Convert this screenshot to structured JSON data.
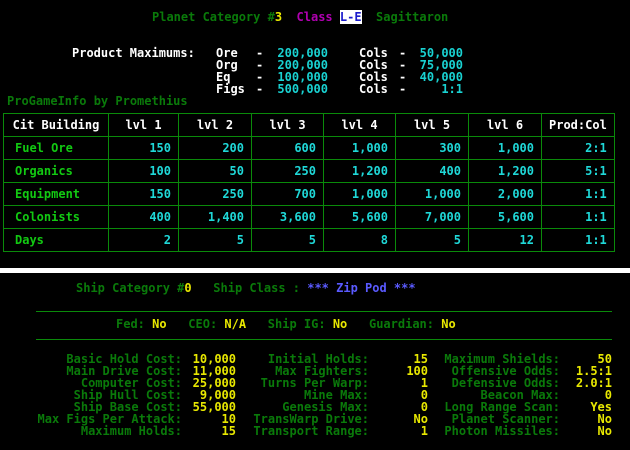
{
  "planet": {
    "cat_label": "Planet Category #",
    "cat_num": "3",
    "class_label": "Class",
    "class_code": "L-E",
    "class_name": "Sagittaron"
  },
  "products": {
    "label": "Product Maximums:",
    "rows": [
      {
        "name": "Ore",
        "dash": "-",
        "value": "200,000",
        "cols_label": "Cols",
        "cols_dash": "-",
        "cols_value": "50,000"
      },
      {
        "name": "Org",
        "dash": "-",
        "value": "200,000",
        "cols_label": "Cols",
        "cols_dash": "-",
        "cols_value": "75,000"
      },
      {
        "name": "Eq",
        "dash": "-",
        "value": "100,000",
        "cols_label": "Cols",
        "cols_dash": "-",
        "cols_value": "40,000"
      },
      {
        "name": "Figs",
        "dash": "-",
        "value": "500,000",
        "cols_label": "Cols",
        "cols_dash": "-",
        "cols_value": "1:1"
      }
    ]
  },
  "credit": "ProGameInfo by Promethius",
  "citadel": {
    "headers": [
      "Cit Building",
      "lvl 1",
      "lvl 2",
      "lvl 3",
      "lvl 4",
      "lvl 5",
      "lvl 6",
      "Prod:Col"
    ],
    "rows": [
      [
        "Fuel Ore",
        "150",
        "200",
        "600",
        "1,000",
        "300",
        "1,000",
        "2:1"
      ],
      [
        "Organics",
        "100",
        "50",
        "250",
        "1,200",
        "400",
        "1,200",
        "5:1"
      ],
      [
        "Equipment",
        "150",
        "250",
        "700",
        "1,000",
        "1,000",
        "2,000",
        "1:1"
      ],
      [
        "Colonists",
        "400",
        "1,400",
        "3,600",
        "5,600",
        "7,000",
        "5,600",
        "1:1"
      ],
      [
        "Days",
        "2",
        "5",
        "5",
        "8",
        "5",
        "12",
        "1:1"
      ]
    ]
  },
  "ship": {
    "cat_label": "Ship Category #",
    "cat_num": "0",
    "class_label": "Ship Class :",
    "class_name": "*** Zip Pod ***",
    "flags": [
      {
        "label": "Fed:",
        "value": "No"
      },
      {
        "label": "CEO:",
        "value": "N/A"
      },
      {
        "label": "Ship IG:",
        "value": "No"
      },
      {
        "label": "Guardian:",
        "value": "No"
      }
    ],
    "stats_col1": [
      {
        "label": "Basic Hold Cost:",
        "value": "10,000"
      },
      {
        "label": "Main Drive Cost:",
        "value": "11,000"
      },
      {
        "label": "Computer Cost:",
        "value": "25,000"
      },
      {
        "label": "Ship Hull Cost:",
        "value": "9,000"
      },
      {
        "label": "Ship Base Cost:",
        "value": "55,000"
      },
      {
        "label": "Max Figs Per Attack:",
        "value": "10"
      },
      {
        "label": "Maximum Holds:",
        "value": "15"
      }
    ],
    "stats_col2": [
      {
        "label": "Initial Holds:",
        "value": "15"
      },
      {
        "label": "Max Fighters:",
        "value": "100"
      },
      {
        "label": "Turns Per Warp:",
        "value": "1"
      },
      {
        "label": "Mine Max:",
        "value": "0"
      },
      {
        "label": "Genesis Max:",
        "value": "0"
      },
      {
        "label": "TransWarp Drive:",
        "value": "No"
      },
      {
        "label": "Transport Range:",
        "value": "1"
      }
    ],
    "stats_col3": [
      {
        "label": "Maximum Shields:",
        "value": "50"
      },
      {
        "label": "Offensive Odds:",
        "value": "1.5:1"
      },
      {
        "label": "Defensive Odds:",
        "value": "2.0:1"
      },
      {
        "label": "Beacon Max:",
        "value": "0"
      },
      {
        "label": "Long Range Scan:",
        "value": "Yes"
      },
      {
        "label": "Planet Scanner:",
        "value": "No"
      },
      {
        "label": "Photon Missiles:",
        "value": "No"
      }
    ]
  }
}
